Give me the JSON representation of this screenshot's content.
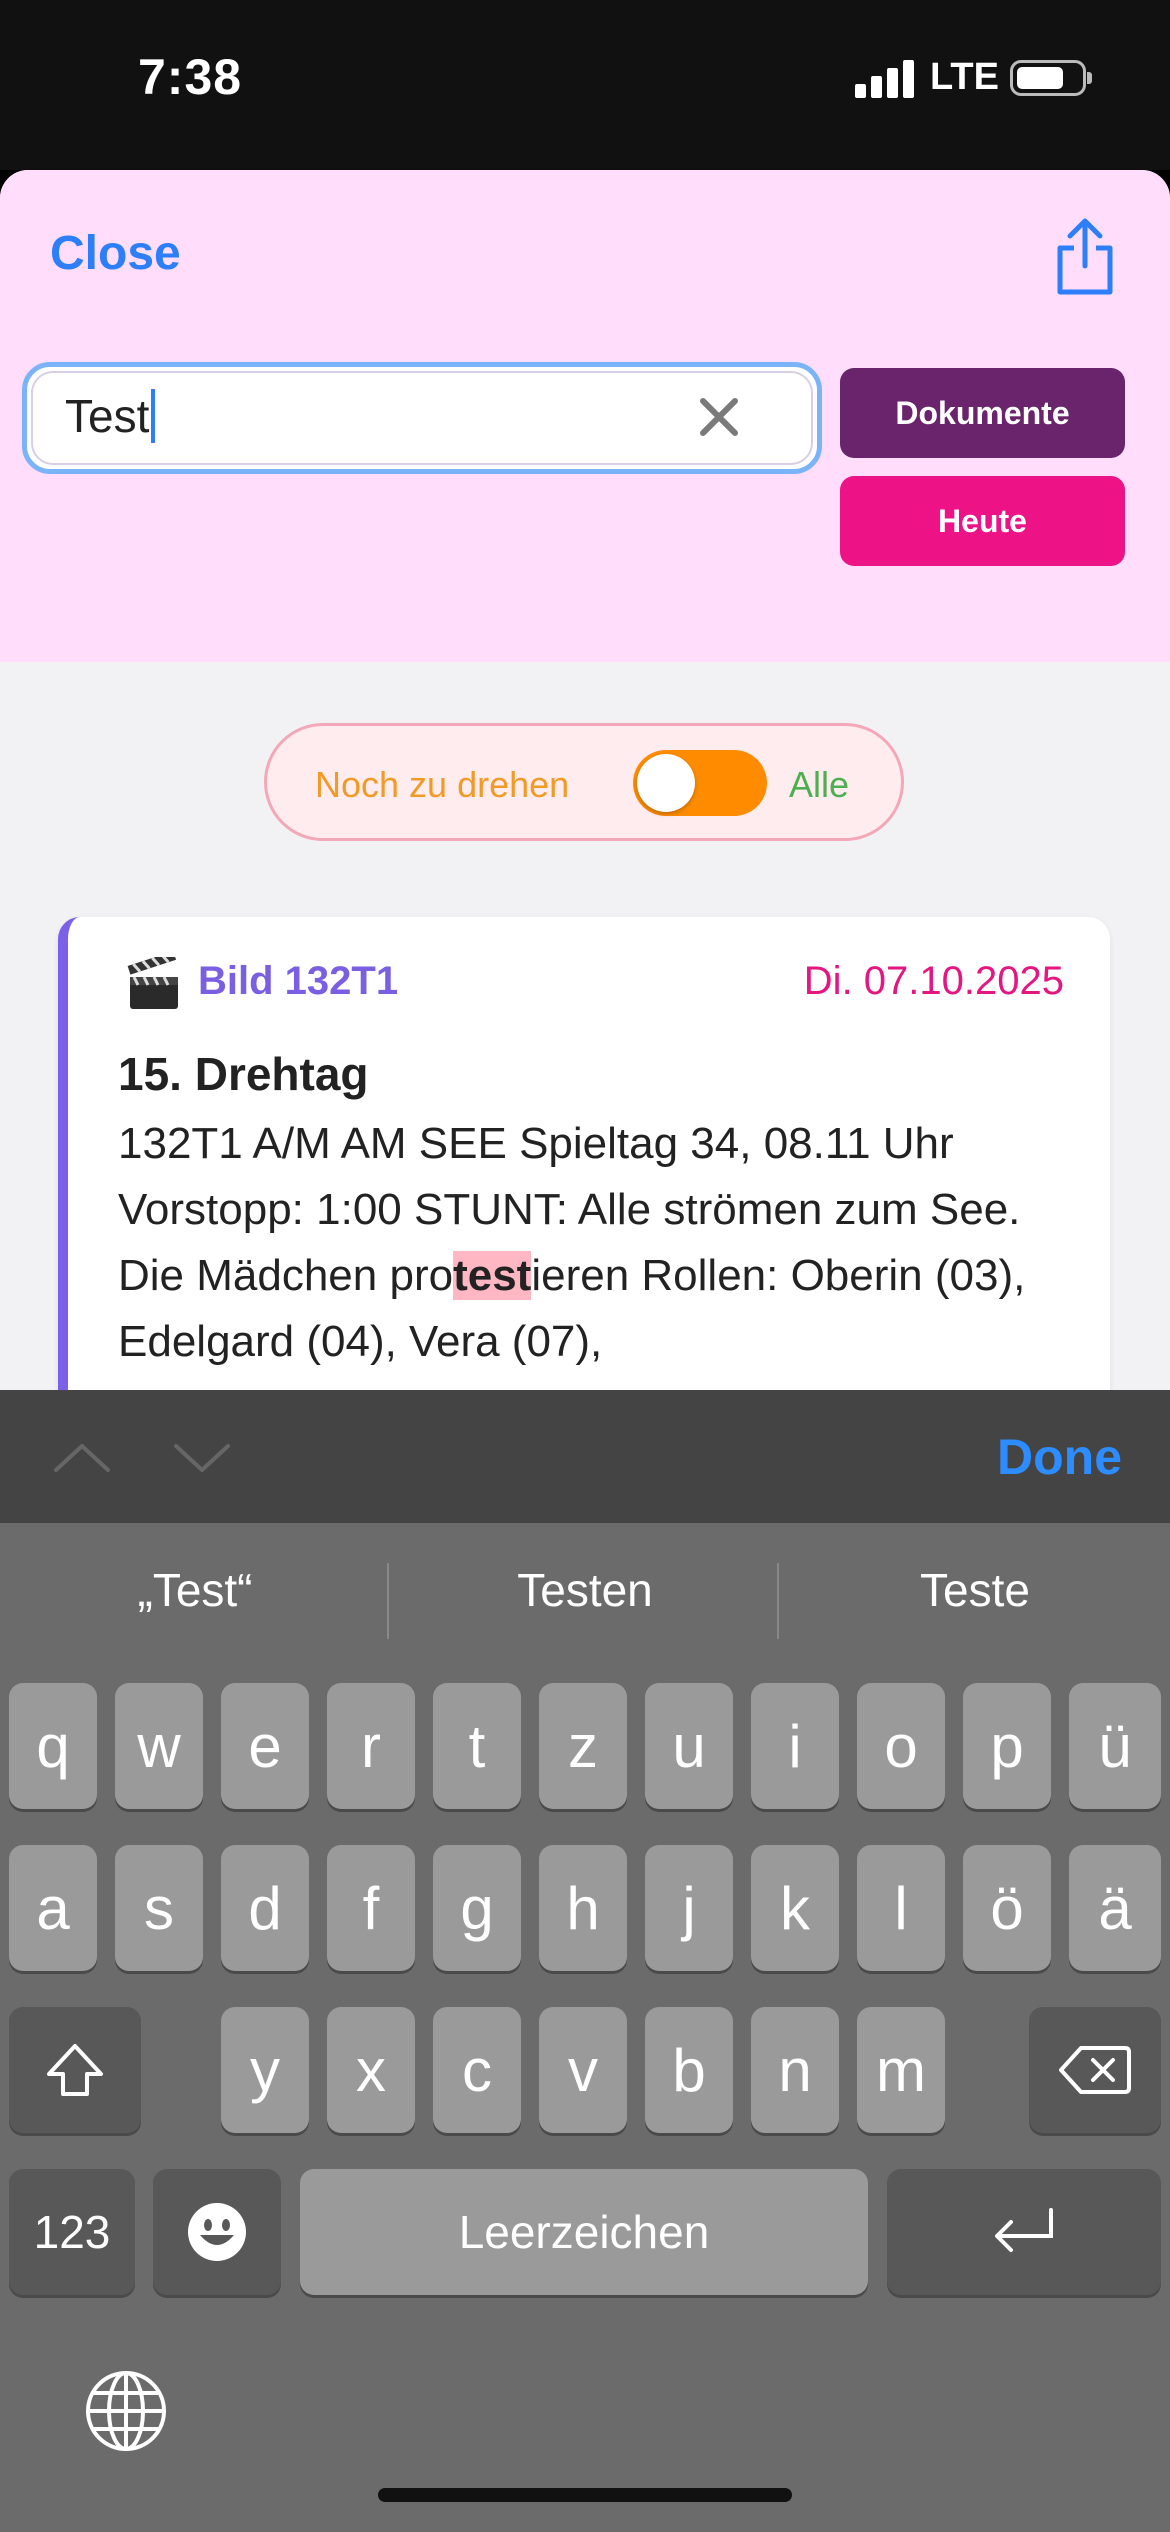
{
  "status": {
    "time": "7:38",
    "network": "LTE",
    "battery_level": 0.75
  },
  "header": {
    "close_label": "Close",
    "share_icon": "share-icon"
  },
  "search": {
    "value": "Test",
    "clear_icon": "xmark-icon"
  },
  "buttons": {
    "dokumente": "Dokumente",
    "heute": "Heute"
  },
  "filter": {
    "left_label": "Noch zu drehen",
    "right_label": "Alle",
    "toggle_on": false
  },
  "card": {
    "icon": "clapperboard-icon",
    "title": "Bild 132T1",
    "date": "Di. 07.10.2025",
    "day": "15. Drehtag",
    "desc_before": "132T1 A/M AM SEE Spieltag 34, 08.11 Uhr Vorstopp: 1:00 STUNT: Alle strömen zum See. Die Mädchen pro",
    "desc_match": "test",
    "desc_after": "ieren Rollen: Oberin (03), Edelgard (04), Vera (07),"
  },
  "accessory": {
    "done_label": "Done"
  },
  "keyboard": {
    "suggestions": [
      "„Test“",
      "Testen",
      "Teste"
    ],
    "row1": [
      "q",
      "w",
      "e",
      "r",
      "t",
      "z",
      "u",
      "i",
      "o",
      "p",
      "ü"
    ],
    "row2": [
      "a",
      "s",
      "d",
      "f",
      "g",
      "h",
      "j",
      "k",
      "l",
      "ö",
      "ä"
    ],
    "row3": [
      "y",
      "x",
      "c",
      "v",
      "b",
      "n",
      "m"
    ],
    "numbers_label": "123",
    "space_label": "Leerzeichen"
  },
  "colors": {
    "accent_blue": "#2d7ff9",
    "header_bg": "#ffddfb",
    "dokumente": "#6a246b",
    "heute": "#ee1287",
    "toggle": "#ff8c00",
    "card_bar": "#7b61e8",
    "date": "#e3177f",
    "highlight": "#ffb7c3"
  }
}
